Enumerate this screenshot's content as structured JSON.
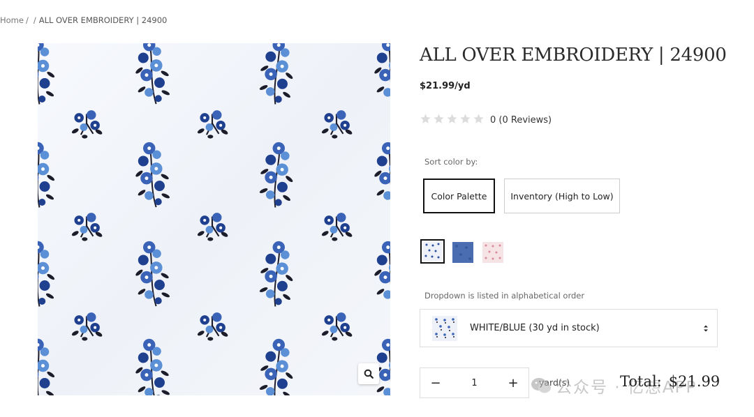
{
  "breadcrumb": {
    "home": "Home",
    "sep1": "/",
    "sep2": "/",
    "current": "ALL OVER EMBROIDERY | 24900"
  },
  "product": {
    "title": "ALL OVER EMBROIDERY | 24900",
    "price": "$21.99/yd",
    "rating_text": "0 (0 Reviews)",
    "stars_filled": 0,
    "stars_total": 5
  },
  "sort": {
    "label": "Sort color by:",
    "options": [
      "Color Palette",
      "Inventory (High to Low)"
    ],
    "selected": "Color Palette"
  },
  "swatches": [
    {
      "name": "white-blue",
      "color": "#eef2f8",
      "selected": true
    },
    {
      "name": "blue",
      "color": "#4a6cb0",
      "selected": false
    },
    {
      "name": "pink",
      "color": "#f6e3e6",
      "selected": false
    }
  ],
  "dropdown": {
    "label": "Dropdown is listed in alphabetical order",
    "selected": "WHITE/BLUE (30 yd in stock)"
  },
  "quantity": {
    "minus": "−",
    "value": "1",
    "plus": "+",
    "unit": "yard(s)"
  },
  "total": {
    "label": "Total:",
    "amount": "$21.99"
  },
  "watermark": {
    "text": "公众号 · 亿想APP"
  },
  "colors": {
    "embroidery_dark": "#1f3f8f",
    "embroidery_light": "#5b8fd6",
    "embroidery_black": "#1c1c2a",
    "fabric": "#f3f6fb",
    "star_empty": "#dcdcdc"
  }
}
